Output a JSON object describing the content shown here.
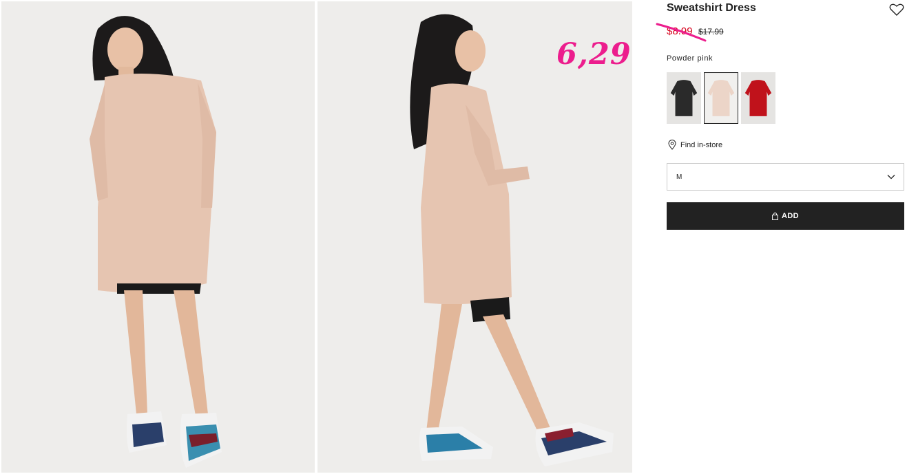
{
  "product": {
    "title": "Sweatshirt Dress",
    "sale_price": "$8.99",
    "old_price": "$17.99",
    "handwritten_price": "6,29",
    "color_label": "Powder pink",
    "swatches": [
      {
        "color_name": "Black",
        "hex": "#2a2a2a",
        "selected": false
      },
      {
        "color_name": "Powder pink",
        "hex": "#ecd5c8",
        "selected": true
      },
      {
        "color_name": "Red",
        "hex": "#c0121b",
        "selected": false
      }
    ],
    "find_in_store_label": "Find in-store",
    "size_value": "M",
    "add_button_label": "ADD"
  },
  "colors": {
    "accent_pink": "#ec1d8d",
    "sale_red": "#d6001c",
    "button_dark": "#222222",
    "photo_bg": "#eeedeb",
    "dress": "#e6c5b1"
  },
  "icons": {
    "favorite": "heart-icon",
    "store": "location-pin-icon",
    "dropdown": "chevron-down-icon",
    "add": "shopping-bag-icon"
  }
}
